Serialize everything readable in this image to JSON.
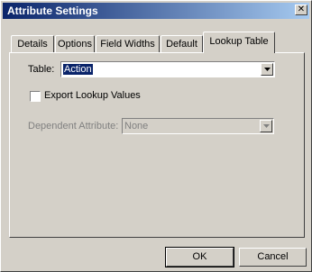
{
  "window": {
    "title": "Attribute Settings",
    "close_label": "✕"
  },
  "tabs": [
    {
      "label": "Details",
      "active": false
    },
    {
      "label": "Options",
      "active": false
    },
    {
      "label": "Field Widths",
      "active": false
    },
    {
      "label": "Default",
      "active": false
    },
    {
      "label": "Lookup Table",
      "active": true
    }
  ],
  "lookup": {
    "table_label": "Table:",
    "table_value": "Action",
    "export_label": "Export Lookup Values",
    "export_checked": false,
    "dependent_label": "Dependent Attribute:",
    "dependent_value": "None",
    "dependent_enabled": false
  },
  "buttons": {
    "ok": "OK",
    "cancel": "Cancel"
  },
  "colors": {
    "title_start": "#0a246a",
    "title_end": "#a6caf0",
    "face": "#d4d0c8",
    "selection": "#0a246a"
  },
  "icons": {
    "close": "close-icon",
    "dropdown": "chevron-down-icon"
  }
}
